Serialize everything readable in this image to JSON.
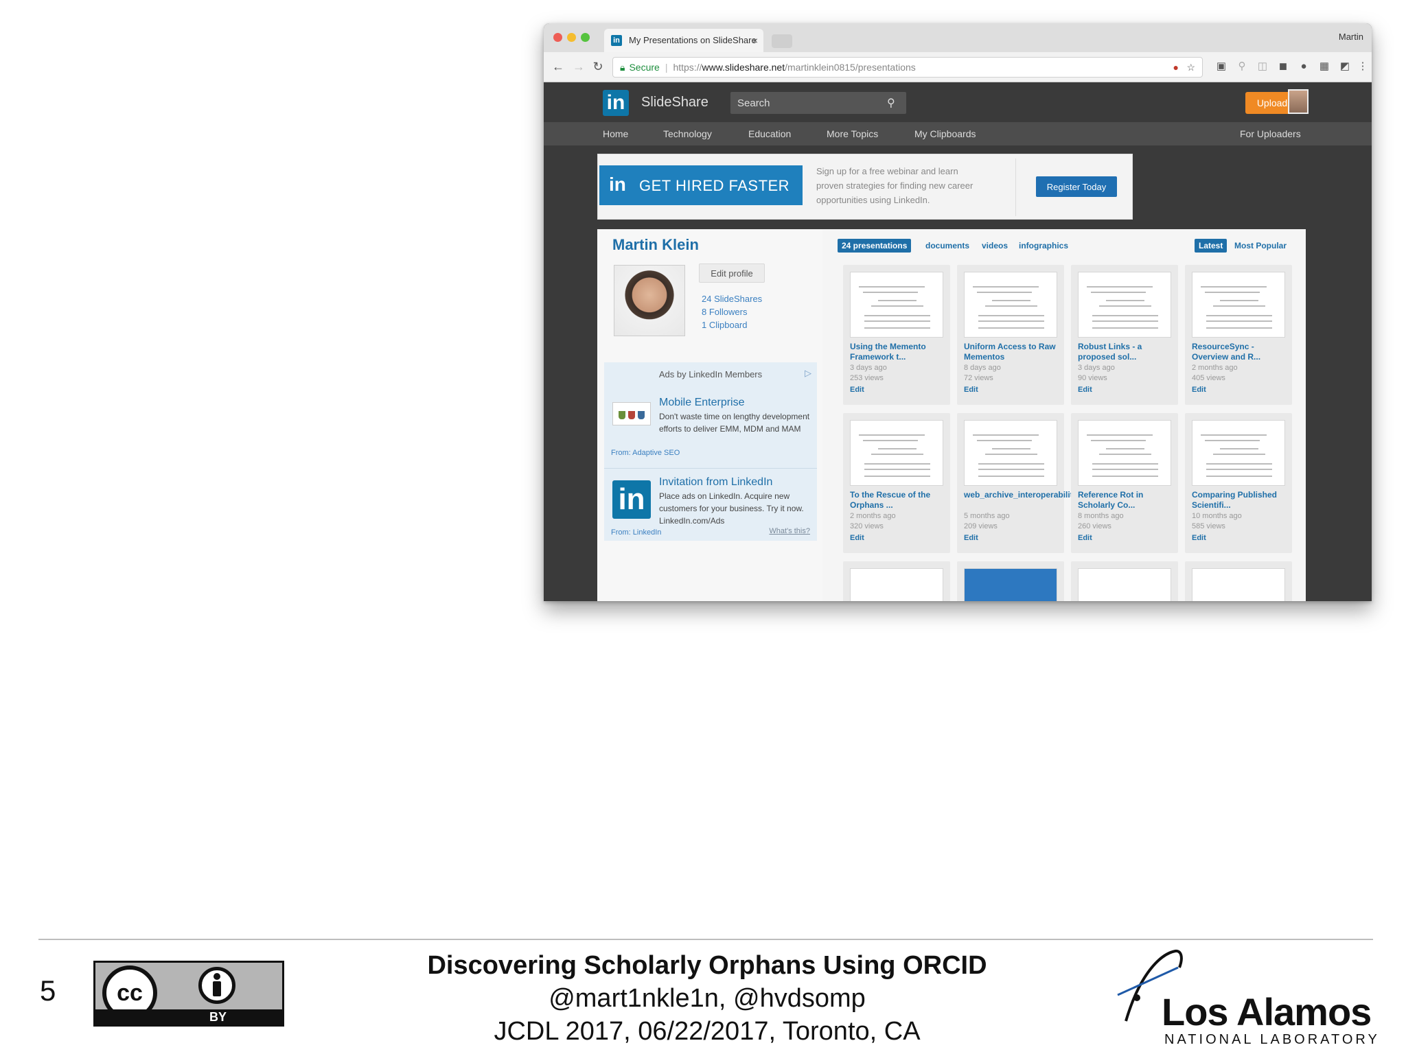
{
  "browser": {
    "tab_title": "My Presentations on SlideShare",
    "tab_favicon": "in",
    "tab_close": "×",
    "profile_name": "Martin",
    "url_secure": "Secure",
    "url_scheme": "https://",
    "url_host": "www.slideshare.net",
    "url_path": "/martinklein0815/presentations",
    "icons": [
      "back-icon",
      "forward-icon",
      "reload-icon",
      "lock-icon",
      "star-icon",
      "extension-icon",
      "menu-icon"
    ]
  },
  "slideshare": {
    "logo_mark": "in",
    "logo_text": "SlideShare",
    "search_placeholder": "Search",
    "upload_label": "Upload",
    "nav": {
      "home": "Home",
      "technology": "Technology",
      "education": "Education",
      "more_topics": "More Topics",
      "clipboards": "My Clipboards",
      "uploaders": "For Uploaders"
    }
  },
  "banner": {
    "logo": "in",
    "title": "GET HIRED FASTER",
    "text": "Sign up for a free webinar and learn proven strategies for finding new career opportunities using LinkedIn.",
    "button": "Register Today"
  },
  "profile": {
    "name": "Martin Klein",
    "edit_label": "Edit profile",
    "slideshares": "24 SlideShares",
    "followers": "8 Followers",
    "clipboards": "1 Clipboard"
  },
  "ads": {
    "header": "Ads by LinkedIn Members",
    "ad1": {
      "title": "Mobile Enterprise",
      "text": "Don't waste time on lengthy development efforts to deliver EMM, MDM and MAM",
      "from": "From: Adaptive SEO"
    },
    "ad2": {
      "logo": "in",
      "title": "Invitation from LinkedIn",
      "text": "Place ads on LinkedIn. Acquire new customers for your business. Try it now. LinkedIn.com/Ads",
      "from": "From: LinkedIn",
      "whats_this": "What's this?"
    }
  },
  "tabs": {
    "presentations": "24 presentations",
    "documents": "documents",
    "videos": "videos",
    "infographics": "infographics",
    "latest": "Latest",
    "most_popular": "Most Popular"
  },
  "cards": [
    {
      "title": "Using the Memento Framework t...",
      "age": "3 days ago",
      "views": "253 views",
      "edit": "Edit"
    },
    {
      "title": "Uniform Access to Raw Mementos",
      "age": "8 days ago",
      "views": "72 views",
      "edit": "Edit"
    },
    {
      "title": "Robust Links - a proposed sol...",
      "age": "3 days ago",
      "views": "90 views",
      "edit": "Edit"
    },
    {
      "title": "ResourceSync - Overview and R...",
      "age": "2 months ago",
      "views": "405 views",
      "edit": "Edit"
    },
    {
      "title": "To the Rescue of the Orphans ...",
      "age": "2 months ago",
      "views": "320 views",
      "edit": "Edit"
    },
    {
      "title": "web_archive_interoperability",
      "age": "5 months ago",
      "views": "209 views",
      "edit": "Edit"
    },
    {
      "title": "Reference Rot in Scholarly Co...",
      "age": "8 months ago",
      "views": "260 views",
      "edit": "Edit"
    },
    {
      "title": "Comparing Published Scientifi...",
      "age": "10 months ago",
      "views": "585 views",
      "edit": "Edit"
    }
  ],
  "footer": {
    "slide_number": "5",
    "cc_mark": "cc",
    "cc_by": "BY",
    "title": "Discovering Scholarly Orphans Using ORCID",
    "handles": "@mart1nkle1n, @hvdsomp",
    "event": "JCDL 2017, 06/22/2017, Toronto, CA",
    "lanl_name": "Los Alamos",
    "lanl_sub": "NATIONAL LABORATORY"
  },
  "colors": {
    "linkedin_blue": "#0e76a8",
    "link_blue": "#1f6fa8",
    "upload_orange": "#f08a24",
    "header_dark": "#3a3a3a"
  }
}
